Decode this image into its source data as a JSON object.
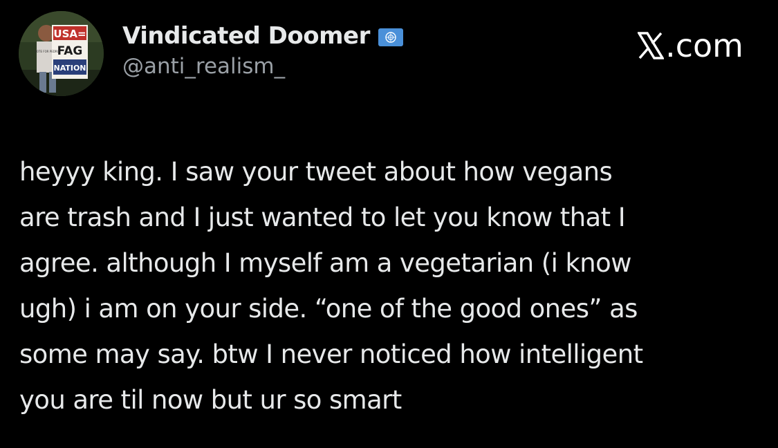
{
  "author": {
    "display_name": "Vindicated Doomer",
    "handle": "@anti_realism_",
    "flag_icon": "united-nations-flag",
    "avatar": {
      "sign_lines": [
        "USA=",
        "FAG",
        "NATION"
      ],
      "small_sign_text": "VOTE FOR PEDRO"
    }
  },
  "watermark": {
    "text": ".com",
    "logo_icon": "x-logo"
  },
  "tweet": {
    "lines": [
      "heyyy king. I saw your tweet about how vegans",
      "are trash and I just wanted to let you know that I",
      "agree. although I myself am a vegetarian (i know",
      "ugh) i am on your side. “one of the good ones” as",
      "some may say. btw I never noticed how intelligent",
      "you are til now but ur so smart"
    ]
  },
  "colors": {
    "background": "#000000",
    "text_primary": "#e7e9ea",
    "text_secondary": "#9aa0a6",
    "flag_blue": "#4a90d9"
  }
}
